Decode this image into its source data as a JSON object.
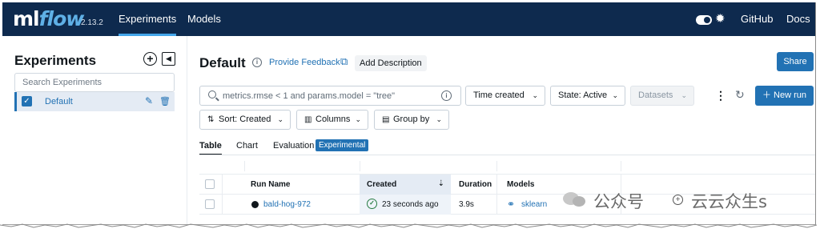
{
  "topbar": {
    "logo_ml": "ml",
    "logo_flow": "flow",
    "version": "2.13.2",
    "nav": [
      "Experiments",
      "Models"
    ],
    "right_links": [
      "GitHub",
      "Docs"
    ]
  },
  "sidebar": {
    "title": "Experiments",
    "search_placeholder": "Search Experiments",
    "experiments": [
      {
        "label": "Default",
        "checked": true
      }
    ]
  },
  "header": {
    "title": "Default",
    "feedback": "Provide Feedback",
    "add_description": "Add Description",
    "share": "Share"
  },
  "toolbar": {
    "search_value": "metrics.rmse < 1 and params.model = \"tree\"",
    "sort_time": "Time created",
    "state": "State: Active",
    "datasets": "Datasets",
    "new_run": "New run",
    "sort": "Sort: Created",
    "columns": "Columns",
    "group_by": "Group by"
  },
  "tabs": [
    "Table",
    "Chart",
    "Evaluation"
  ],
  "experimental_badge": "Experimental",
  "table": {
    "columns": [
      "Run Name",
      "Created",
      "Duration",
      "Models"
    ],
    "rows": [
      {
        "run_name": "bald-hog-972",
        "created": "23 seconds ago",
        "duration": "3.9s",
        "model": "sklearn"
      }
    ]
  },
  "watermark": {
    "left": "公众号",
    "right": "云云众生s"
  },
  "colors": {
    "topbar": "#0e2a4e",
    "primary": "#2272b4",
    "success": "#277c43"
  }
}
